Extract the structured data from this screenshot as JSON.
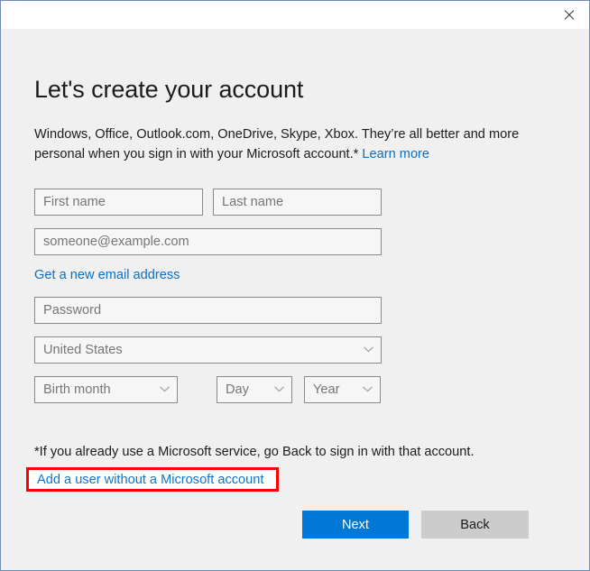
{
  "window": {
    "close_label": "Close",
    "border_color": "#6d8cb0",
    "titlebar_bg": "#ffffff",
    "body_bg": "#f0f0f0"
  },
  "page": {
    "heading": "Let's create your account",
    "description_text": "Windows, Office, Outlook.com, OneDrive, Skype, Xbox. They’re all better and more personal when you sign in with your Microsoft account.* ",
    "learn_more_label": "Learn more"
  },
  "form": {
    "first_name": {
      "placeholder": "First name",
      "value": ""
    },
    "last_name": {
      "placeholder": "Last name",
      "value": ""
    },
    "email": {
      "placeholder": "someone@example.com",
      "value": ""
    },
    "get_new_email_label": "Get a new email address",
    "password": {
      "placeholder": "Password",
      "value": ""
    },
    "country": {
      "selected": "United States"
    },
    "birth_month": {
      "selected": "Birth month"
    },
    "birth_day": {
      "selected": "Day"
    },
    "birth_year": {
      "selected": "Year"
    }
  },
  "footer": {
    "footnote": "*If you already use a Microsoft service, go Back to sign in with that account.",
    "add_user_link_label": "Add a user without a Microsoft account",
    "highlight_color": "#fe0000"
  },
  "buttons": {
    "next_label": "Next",
    "back_label": "Back",
    "primary_color": "#0078d7",
    "secondary_color": "#cccccc"
  }
}
